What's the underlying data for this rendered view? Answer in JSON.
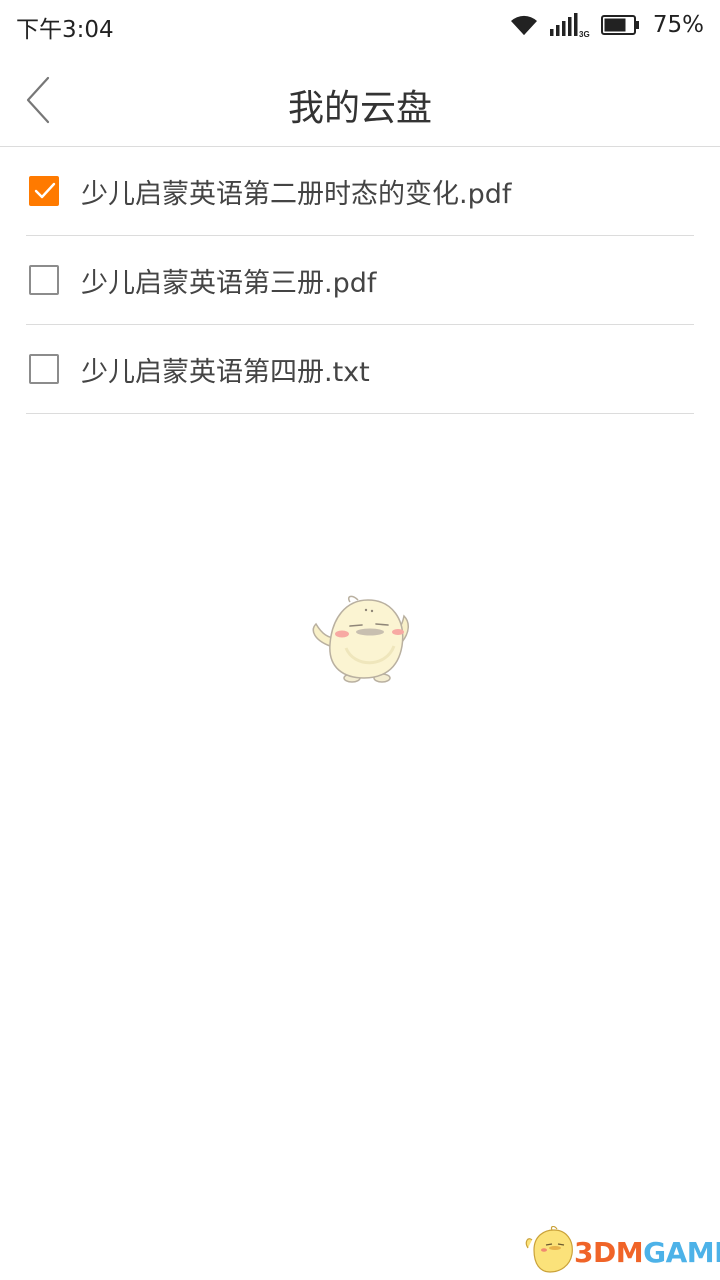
{
  "status_bar": {
    "time": "下午3:04",
    "network": "3G",
    "battery_percent": "75%",
    "battery_level": 0.75,
    "icons": [
      "wifi-icon",
      "cellular-signal-icon",
      "battery-icon"
    ]
  },
  "header": {
    "title": "我的云盘",
    "back_icon": "chevron-left-icon"
  },
  "files": [
    {
      "name": "少儿启蒙英语第二册时态的变化.pdf",
      "checked": true
    },
    {
      "name": "少儿启蒙英语第三册.pdf",
      "checked": false
    },
    {
      "name": "少儿启蒙英语第四册.txt",
      "checked": false
    }
  ],
  "colors": {
    "accent": "#ff7a00",
    "divider": "#dcdcdc",
    "text": "#333333",
    "checkbox_border": "#8c8c8c"
  },
  "watermark": {
    "part1": "3DM",
    "part2": "GAME",
    "color1": "#f06428",
    "color2": "#4db2e8"
  }
}
